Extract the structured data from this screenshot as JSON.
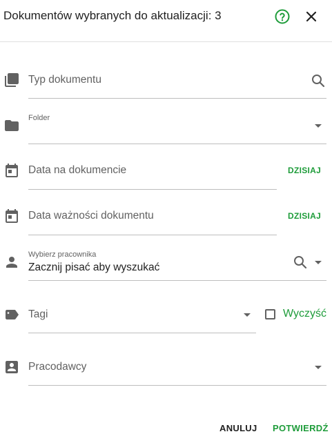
{
  "header": {
    "title": "Dokumentów wybranych do aktualizacji: 3",
    "help_icon": "help-circle-icon",
    "close_icon": "close-icon"
  },
  "fields": {
    "doc_type": {
      "label": "Typ dokumentu",
      "icon": "file-icon"
    },
    "folder": {
      "label": "Folder",
      "icon": "folder-icon"
    },
    "doc_date": {
      "label": "Data na dokumencie",
      "today": "DZISIAJ",
      "icon": "calendar-icon"
    },
    "expiry_date": {
      "label": "Data ważności dokumentu",
      "today": "DZISIAJ",
      "icon": "calendar-icon"
    },
    "employee": {
      "label": "Wybierz pracownika",
      "placeholder": "Zacznij pisać aby wyszukać",
      "icon": "person-icon"
    },
    "tags": {
      "label": "Tagi",
      "clear_label": "Wyczyść",
      "icon": "tag-icon"
    },
    "employers": {
      "label": "Pracodawcy",
      "icon": "badge-icon"
    }
  },
  "actions": {
    "cancel": "ANULUJ",
    "confirm": "POTWIERDŹ"
  },
  "colors": {
    "accent": "#1e9c3a",
    "icon": "#616161",
    "text": "#212121",
    "line": "#bdbdbd"
  }
}
